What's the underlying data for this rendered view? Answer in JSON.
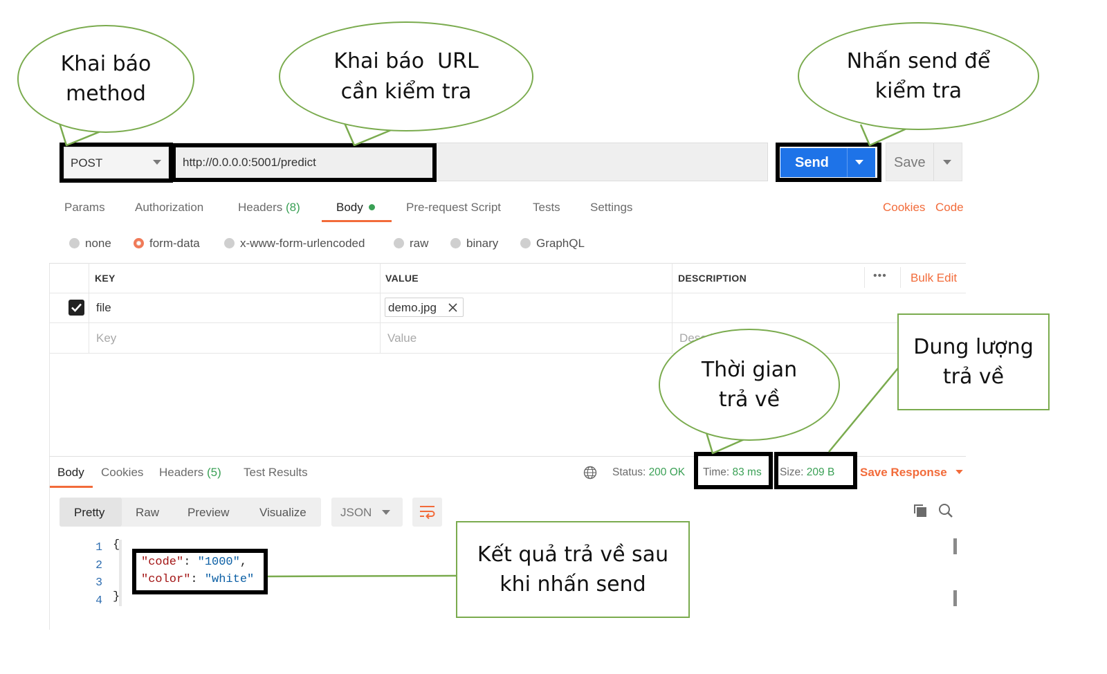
{
  "request": {
    "method": "POST",
    "url": "http://0.0.0.0:5001/predict",
    "send_label": "Send",
    "save_label": "Save"
  },
  "request_tabs": [
    {
      "label": "Params"
    },
    {
      "label": "Authorization"
    },
    {
      "label": "Headers",
      "count": "(8)"
    },
    {
      "label": "Body",
      "active": true
    },
    {
      "label": "Pre-request Script"
    },
    {
      "label": "Tests"
    },
    {
      "label": "Settings"
    }
  ],
  "request_links": {
    "cookies": "Cookies",
    "code": "Code"
  },
  "body_types": [
    {
      "label": "none"
    },
    {
      "label": "form-data",
      "selected": true
    },
    {
      "label": "x-www-form-urlencoded"
    },
    {
      "label": "raw"
    },
    {
      "label": "binary"
    },
    {
      "label": "GraphQL"
    }
  ],
  "form_table": {
    "headers": {
      "key": "KEY",
      "value": "VALUE",
      "description": "DESCRIPTION"
    },
    "bulk_edit": "Bulk Edit",
    "more": "•••",
    "rows": [
      {
        "checked": true,
        "key": "file",
        "value": "demo.jpg"
      }
    ],
    "placeholders": {
      "key": "Key",
      "value": "Value",
      "description": "Description"
    }
  },
  "response": {
    "tabs": [
      {
        "label": "Body",
        "active": true
      },
      {
        "label": "Cookies"
      },
      {
        "label": "Headers",
        "count": "(5)"
      },
      {
        "label": "Test Results"
      }
    ],
    "status_label": "Status:",
    "status_value": "200 OK",
    "time_label": "Time:",
    "time_value": "83 ms",
    "size_label": "Size:",
    "size_value": "209 B",
    "save_response": "Save Response",
    "view_modes": [
      "Pretty",
      "Raw",
      "Preview",
      "Visualize"
    ],
    "format": "JSON",
    "code_lines": [
      "1",
      "2",
      "3",
      "4"
    ],
    "json": {
      "open": "{",
      "close": "}",
      "k1": "\"code\"",
      "v1": "\"1000\"",
      "k2": "\"color\"",
      "v2": "\"white\""
    }
  },
  "annotations": {
    "method": [
      "Khai báo",
      "method"
    ],
    "url": [
      "Khai báo  URL",
      "cần kiểm tra"
    ],
    "send": [
      "Nhấn send để",
      "kiểm tra"
    ],
    "time": [
      "Thời gian",
      "trả về"
    ],
    "size": [
      "Dung lượng",
      "trả về"
    ],
    "result": [
      "Kết quả trả về sau",
      "khi nhấn send"
    ]
  },
  "colors": {
    "accent": "#f26b3a",
    "send_blue": "#1e73e8",
    "status_green": "#3aa055",
    "annotation_border": "#7aab4e",
    "json_key": "#a31515",
    "json_value": "#0b5fa5"
  },
  "icons": [
    "chevron-down-icon",
    "globe-icon",
    "copy-icon",
    "search-icon",
    "wrap-icon",
    "close-icon",
    "checkbox-icon",
    "more-icon"
  ]
}
